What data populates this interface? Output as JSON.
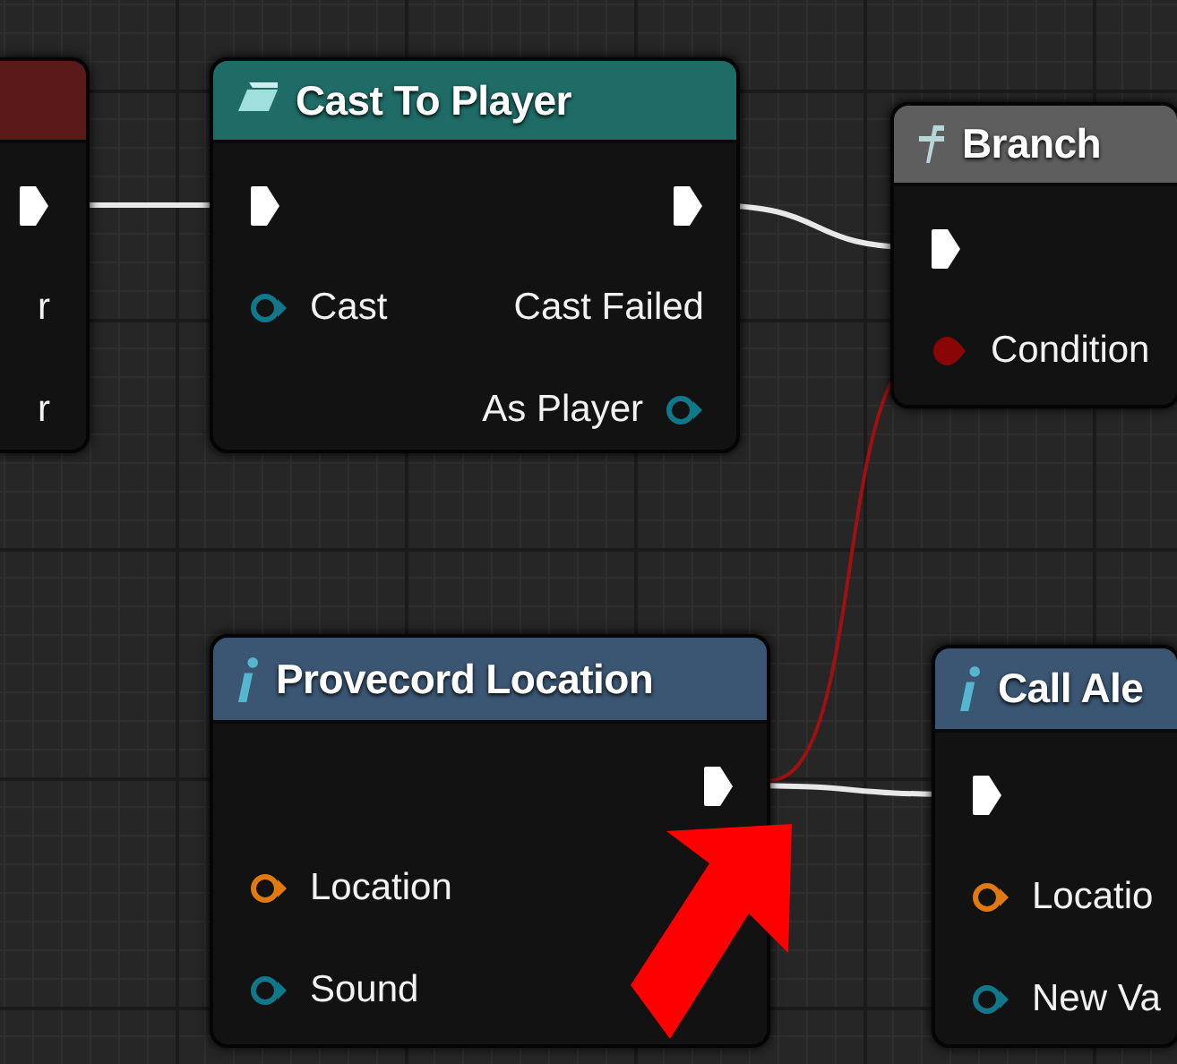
{
  "nodes": [
    {
      "color": "#5a1a1a",
      "rows": [
        {
          "right": {
            "kind": "exec"
          }
        },
        {
          "left": {
            "kind": "none",
            "label": "r"
          }
        },
        {
          "left": {
            "kind": "none",
            "label": "r"
          }
        }
      ]
    },
    {
      "title": "Cast To Player",
      "kind": "cast",
      "color": "#1f6b66",
      "rows": [
        {
          "left": {
            "kind": "exec"
          },
          "right": {
            "kind": "exec"
          }
        },
        {
          "left": {
            "kind": "object",
            "label": "Cast"
          },
          "right": {
            "kind": "none",
            "label": "Cast Failed"
          }
        },
        {
          "right": {
            "kind": "object",
            "label": "As Player"
          }
        }
      ]
    },
    {
      "title": "Branch",
      "kind": "function",
      "color": "#5e5e5e",
      "rows": [
        {
          "left": {
            "kind": "exec"
          }
        },
        {
          "left": {
            "kind": "bool",
            "label": "Condition"
          }
        }
      ]
    },
    {
      "title": "Provecord Location",
      "kind": "info",
      "color": "#3a5673",
      "rows": [
        {
          "right": {
            "kind": "exec"
          }
        },
        {
          "left": {
            "kind": "vector",
            "label": "Location"
          }
        },
        {
          "left": {
            "kind": "object",
            "label": "Sound"
          }
        }
      ]
    },
    {
      "title": "Call Ale",
      "kind": "info",
      "color": "#3a5673",
      "rows": [
        {
          "left": {
            "kind": "exec"
          }
        },
        {
          "left": {
            "kind": "vector",
            "label": "Locatio"
          }
        },
        {
          "left": {
            "kind": "object",
            "label": "New Va"
          }
        }
      ]
    }
  ],
  "wires": [
    {
      "kind": "exec"
    },
    {
      "kind": "exec"
    },
    {
      "kind": "bool"
    },
    {
      "kind": "exec"
    }
  ],
  "annotations": [
    {
      "kind": "arrow"
    }
  ]
}
